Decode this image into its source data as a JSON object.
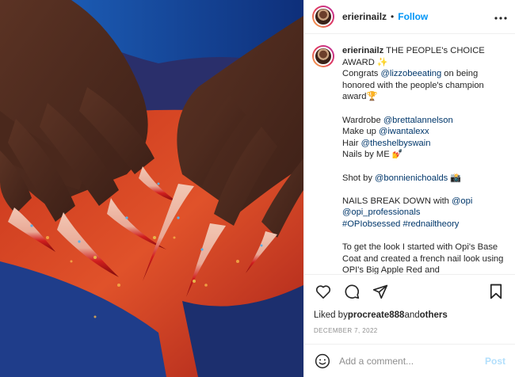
{
  "post": {
    "author": "erierinailz",
    "dot": "•",
    "follow_label": "Follow",
    "more_label": "•••"
  },
  "caption": {
    "username": "erierinailz",
    "line1": " THE PEOPLE's CHOICE AWARD ✨",
    "congrats_pre": "Congrats ",
    "congrats_mention": "@lizzobeeating",
    "congrats_post": " on being honored with the people's champion award🏆",
    "wardrobe_label": "Wardrobe ",
    "wardrobe_mention": "@brettalannelson",
    "makeup_label": "Make up ",
    "makeup_mention": "@iwantalexx",
    "hair_label": "Hair ",
    "hair_mention": "@theshelbyswain",
    "nails_label": "Nails by ME 💅",
    "shot_label": "Shot by ",
    "shot_mention": "@bonnienichoalds",
    "shot_emoji": " 📸",
    "breakdown_label": "NAILS BREAK DOWN with ",
    "breakdown_mention1": "@opi",
    "breakdown_mention2": "@opi_professionals",
    "hashtag1": "#OPIobsessed",
    "hashtag2": "#rednailtheory",
    "look_text": "To get the look I started with Opi's Base Coat and created a french nail look using OPI's Big Apple Red and"
  },
  "actions": {
    "like_icon": "heart-icon",
    "comment_icon": "comment-icon",
    "share_icon": "share-icon",
    "save_icon": "bookmark-icon"
  },
  "likes": {
    "prefix": "Liked by ",
    "user": "procreate888",
    "middle": " and ",
    "others": "others"
  },
  "date": "DECEMBER 7, 2022",
  "add_comment": {
    "placeholder": "Add a comment...",
    "post_label": "Post"
  },
  "colors": {
    "link": "#0095f6",
    "mention": "#00376b",
    "post_disabled": "#b2dffc",
    "muted": "#8e8e8e"
  }
}
